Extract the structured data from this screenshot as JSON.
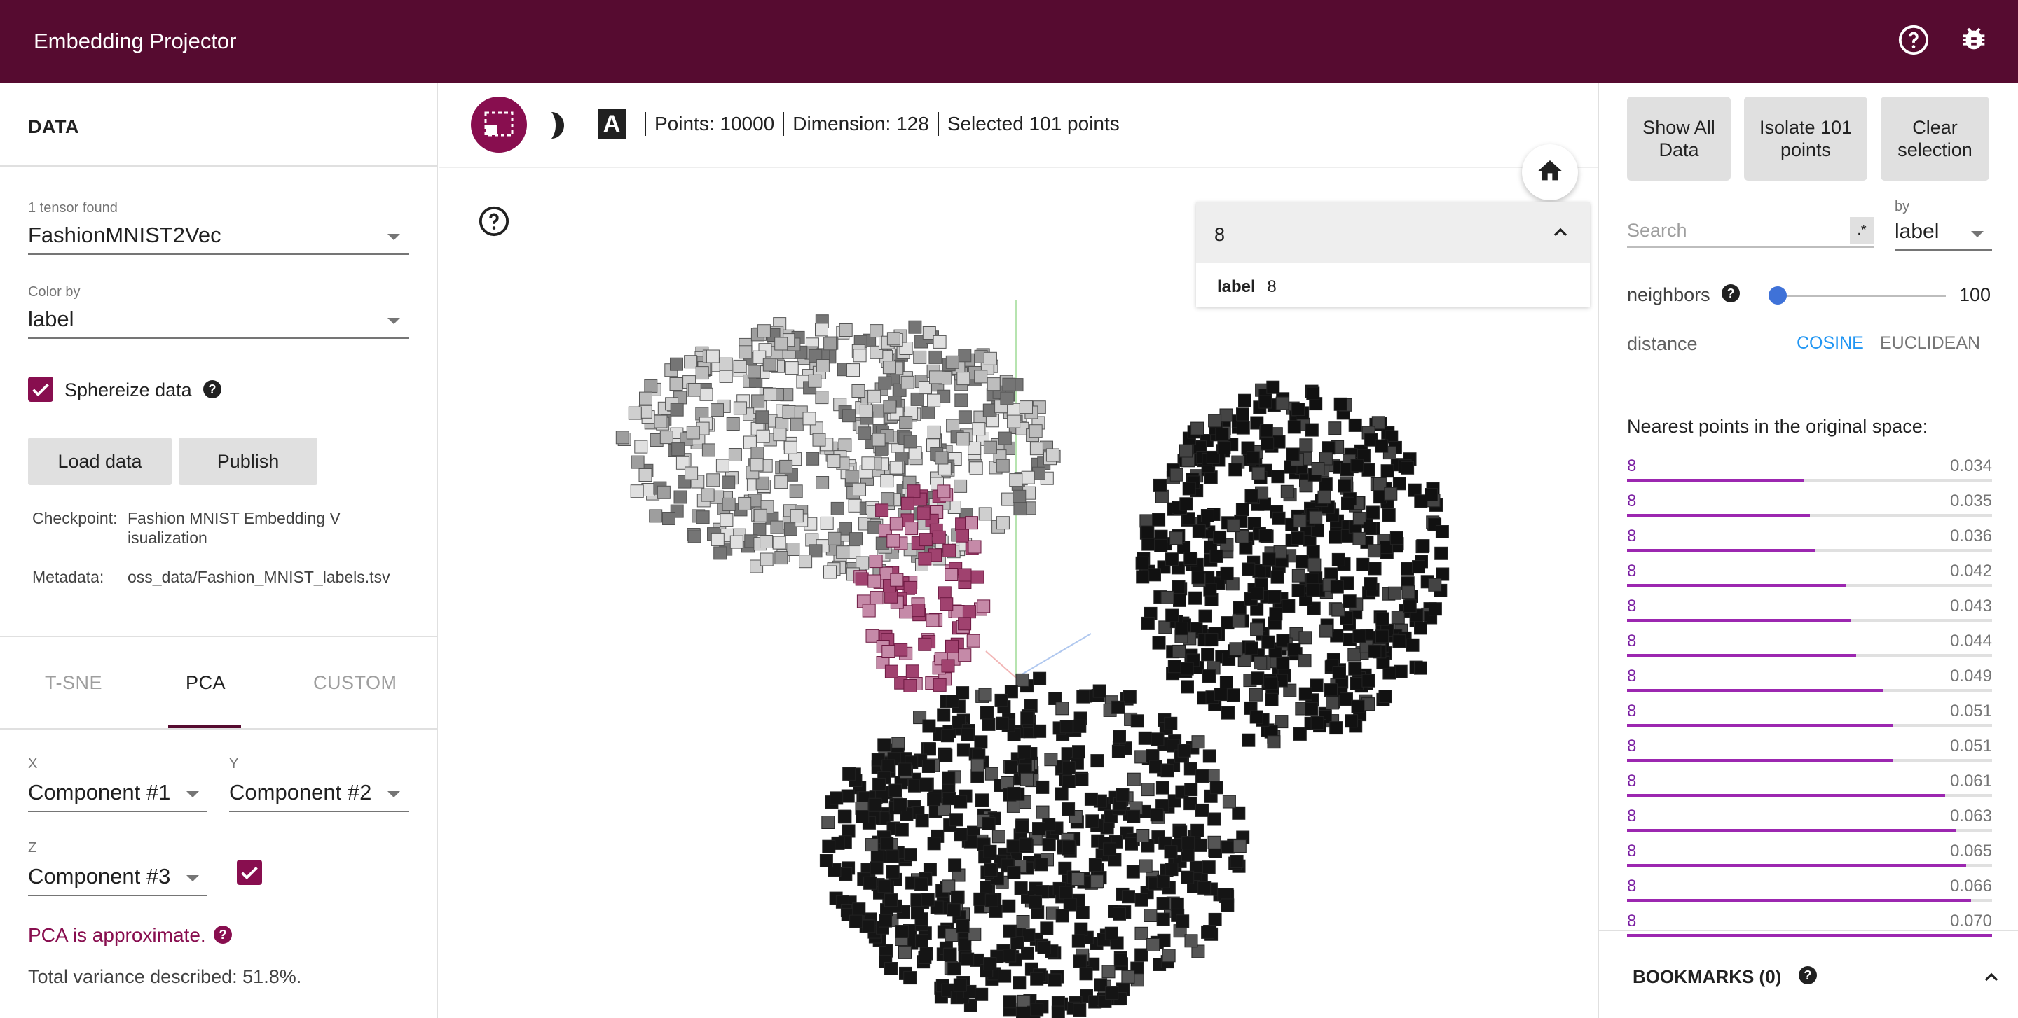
{
  "app": {
    "title": "Embedding Projector"
  },
  "data_panel": {
    "title": "DATA",
    "tensor_count": "1 tensor found",
    "tensor_name": "FashionMNIST2Vec",
    "color_by_label": "Color by",
    "color_by_value": "label",
    "sphereize_label": "Sphereize data",
    "load_button": "Load data",
    "publish_button": "Publish",
    "checkpoint_key": "Checkpoint:",
    "checkpoint_value_1": "Fashion MNIST Embedding V",
    "checkpoint_value_2": "isualization",
    "metadata_key": "Metadata:",
    "metadata_value": "oss_data/Fashion_MNIST_labels.tsv"
  },
  "projection_tabs": [
    "T-SNE",
    "PCA",
    "CUSTOM"
  ],
  "pca": {
    "x_label": "X",
    "x_value": "Component #1",
    "y_label": "Y",
    "y_value": "Component #2",
    "z_label": "Z",
    "z_value": "Component #3",
    "approx_text": "PCA is approximate.",
    "variance_text": "Total variance described: 51.8%."
  },
  "toolbar": {
    "points": "Points: 10000",
    "dimension": "Dimension: 128",
    "selected": "Selected 101 points"
  },
  "label_panel": {
    "header": "8",
    "key": "label",
    "value": "8"
  },
  "inspector": {
    "show_all": "Show All Data",
    "isolate": "Isolate 101 points",
    "clear": "Clear selection",
    "search_placeholder": "Search",
    "regex_toggle": ".*",
    "by_label": "by",
    "by_value": "label",
    "neighbors_label": "neighbors",
    "neighbors_value": "100",
    "neighbors_fraction": 0.02,
    "distance_label": "distance",
    "cosine": "COSINE",
    "euclidean": "EUCLIDEAN",
    "nearest_title": "Nearest points in the original space:",
    "nearest": [
      {
        "label": "8",
        "value": "0.034"
      },
      {
        "label": "8",
        "value": "0.035"
      },
      {
        "label": "8",
        "value": "0.036"
      },
      {
        "label": "8",
        "value": "0.042"
      },
      {
        "label": "8",
        "value": "0.043"
      },
      {
        "label": "8",
        "value": "0.044"
      },
      {
        "label": "8",
        "value": "0.049"
      },
      {
        "label": "8",
        "value": "0.051"
      },
      {
        "label": "8",
        "value": "0.051"
      },
      {
        "label": "8",
        "value": "0.061"
      },
      {
        "label": "8",
        "value": "0.063"
      },
      {
        "label": "8",
        "value": "0.065"
      },
      {
        "label": "8",
        "value": "0.066"
      },
      {
        "label": "8",
        "value": "0.070"
      }
    ],
    "bookmarks": "BOOKMARKS (0)"
  },
  "colors": {
    "brand": "#560b30",
    "accent": "#880e4f",
    "link": "#2196f3",
    "neighbor": "#9c27b0"
  }
}
